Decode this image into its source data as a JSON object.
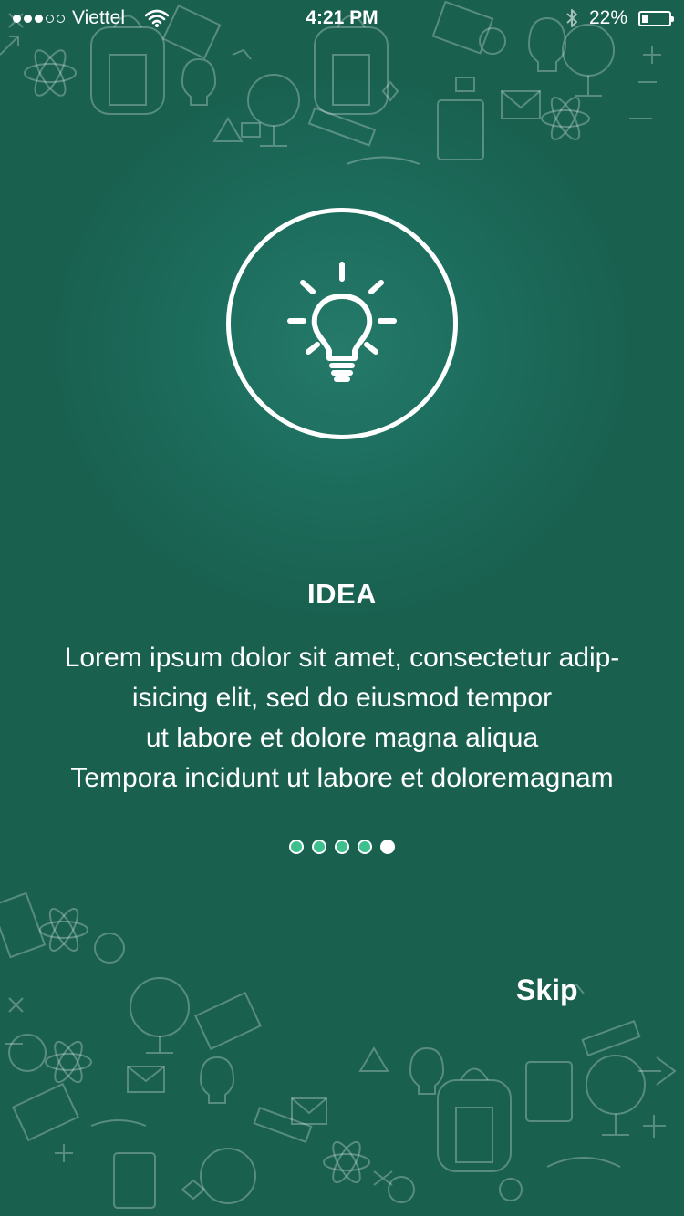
{
  "status_bar": {
    "carrier": "Viettel",
    "time": "4:21 PM",
    "battery": "22%",
    "battery_level": 0.22,
    "icons": [
      "signal-dots-icon",
      "wifi-icon",
      "bluetooth-icon",
      "battery-icon"
    ]
  },
  "onboarding": {
    "icon": "lightbulb-icon",
    "title": "IDEA",
    "description_lines": [
      "Lorem ipsum dolor sit amet, consectetur adip-",
      "isicing elit, sed do eiusmod tempor",
      "ut labore et dolore magna aliqua",
      "Tempora incidunt ut labore et doloremagnam"
    ],
    "pagination": {
      "total": 5,
      "current": 5
    },
    "skip_label": "Skip"
  },
  "colors": {
    "background": "#19604f",
    "background_glow": "#257a69",
    "dot_inactive": "#3dbf8e",
    "foreground": "#ffffff"
  }
}
